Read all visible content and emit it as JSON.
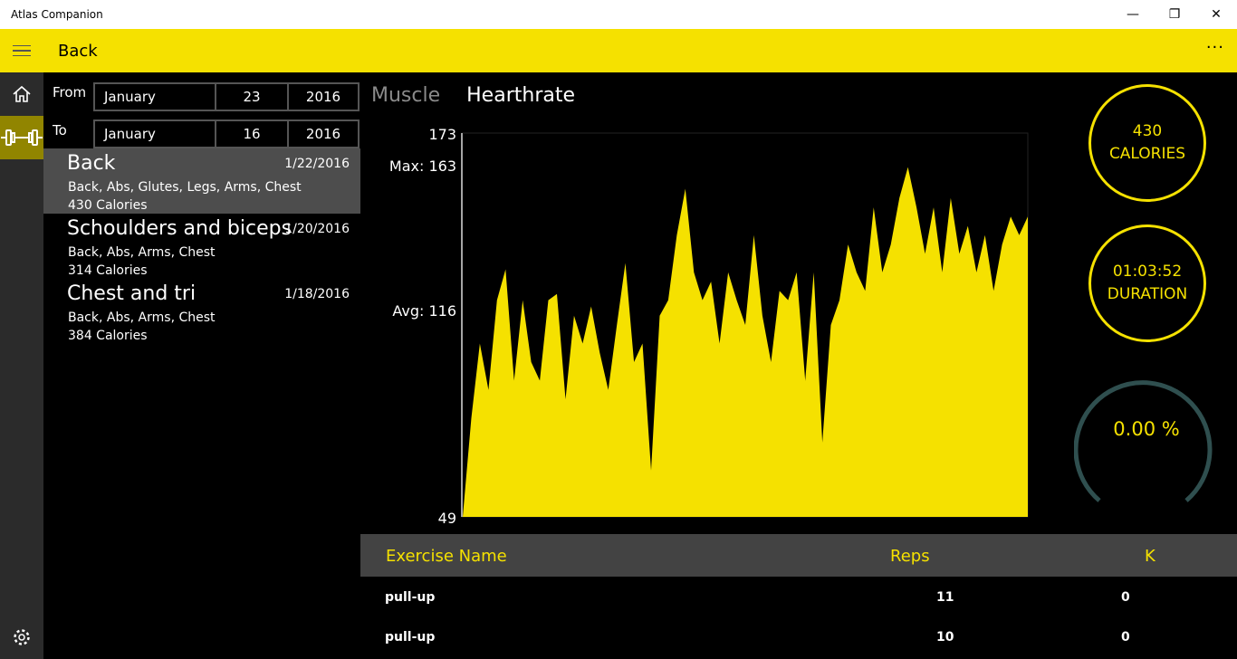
{
  "window": {
    "title": "Atlas Companion",
    "minimize": "—",
    "maximize": "❐",
    "close": "✕"
  },
  "appbar": {
    "title": "Back",
    "more": "···",
    "menu_icon": "hamburger-icon"
  },
  "rail": {
    "items": [
      {
        "icon": "home-icon"
      },
      {
        "icon": "dumbbell-icon",
        "selected": true
      }
    ],
    "settings_icon": "gear-icon"
  },
  "filter": {
    "from_label": "From",
    "from": {
      "month": "January",
      "day": "23",
      "year": "2016"
    },
    "to_label": "To",
    "to": {
      "month": "January",
      "day": "16",
      "year": "2016"
    }
  },
  "workouts": [
    {
      "name": "Back",
      "date": "1/22/2016",
      "muscles": "Back, Abs, Glutes, Legs, Arms, Chest",
      "calories": "430 Calories",
      "selected": true
    },
    {
      "name": "Schoulders and biceps",
      "date": "1/20/2016",
      "muscles": "Back, Abs, Arms, Chest",
      "calories": "314 Calories"
    },
    {
      "name": "Chest and tri",
      "date": "1/18/2016",
      "muscles": "Back, Abs, Arms, Chest",
      "calories": "384 Calories"
    }
  ],
  "tabs": [
    {
      "label": "Muscle",
      "active": false
    },
    {
      "label": "Hearthrate",
      "active": true
    }
  ],
  "chart_data": {
    "type": "area",
    "ylim": [
      49,
      173
    ],
    "y_labels": {
      "top": "173",
      "max": "Max: 163",
      "avg": "Avg: 116",
      "bottom": "49"
    },
    "color": "#f5e100",
    "values": [
      49,
      81,
      105,
      90,
      119,
      129,
      93,
      119,
      99,
      93,
      119,
      121,
      87,
      114,
      105,
      117,
      102,
      90,
      111,
      131,
      99,
      105,
      64,
      114,
      119,
      140,
      155,
      128,
      119,
      125,
      105,
      128,
      119,
      111,
      140,
      114,
      99,
      122,
      119,
      128,
      93,
      128,
      73,
      111,
      119,
      137,
      128,
      122,
      149,
      128,
      137,
      152,
      162,
      149,
      134,
      149,
      128,
      152,
      134,
      143,
      128,
      140,
      122,
      137,
      146,
      140,
      146
    ]
  },
  "stats": {
    "calories_value": "430",
    "calories_label": "CALORIES",
    "duration_value": "01:03:52",
    "duration_label": "DURATION",
    "progress_text": "0.00 %",
    "progress": 0
  },
  "table": {
    "headers": [
      "Exercise Name",
      "Reps",
      "K"
    ],
    "rows": [
      [
        "pull-up",
        "11",
        "0"
      ],
      [
        "pull-up",
        "10",
        "0"
      ]
    ]
  },
  "colors": {
    "accent": "#f5e100",
    "gauge_track": "#2f4f4f",
    "selected_item": "#4d4d4d",
    "rail": "#2b2b2b"
  }
}
